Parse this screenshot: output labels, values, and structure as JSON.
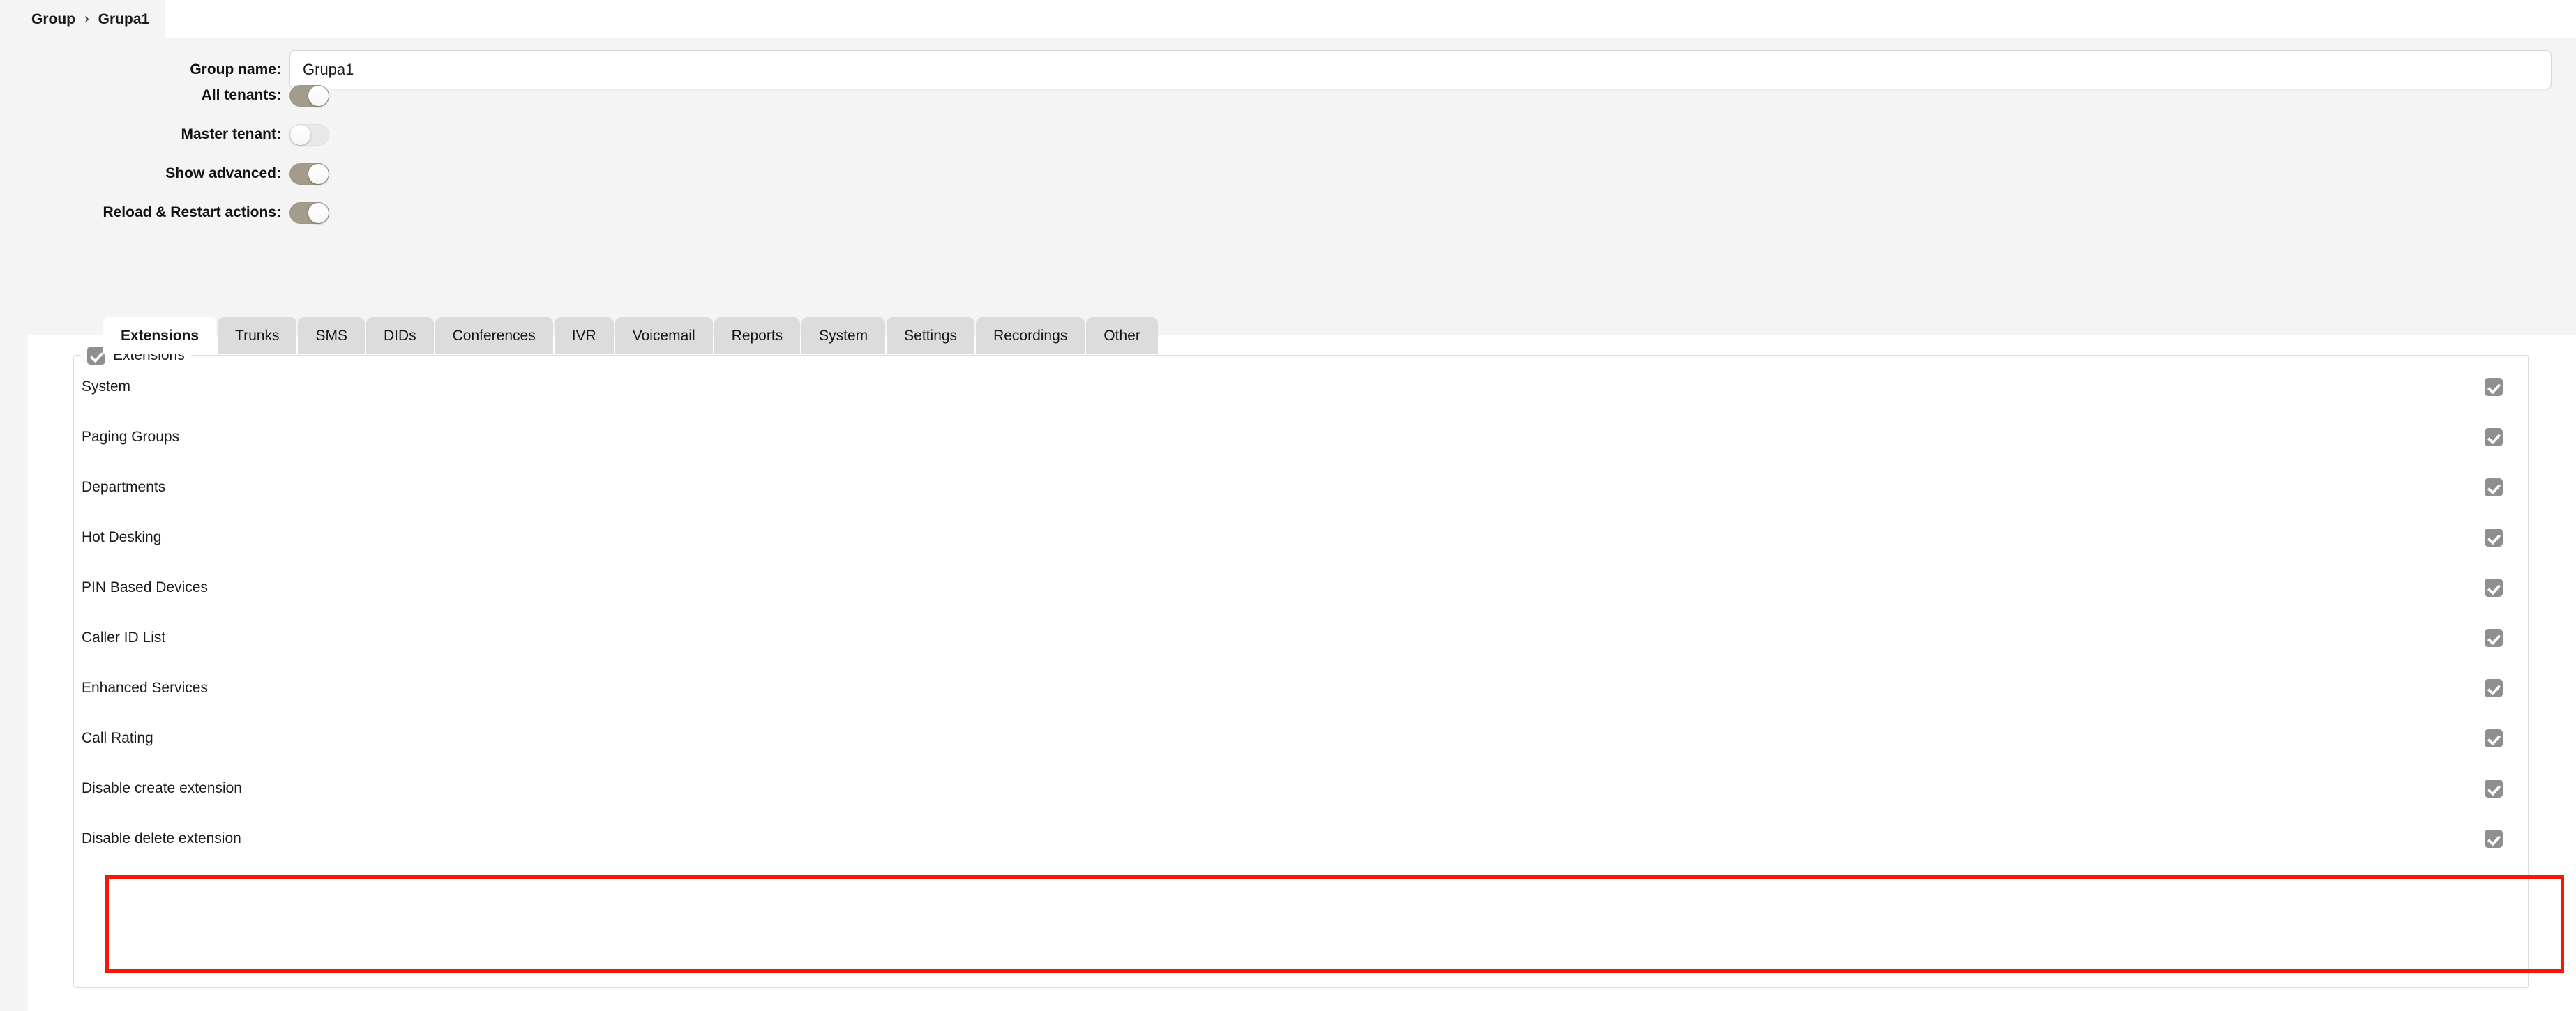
{
  "breadcrumb": {
    "root": "Group",
    "separator": "›",
    "current": "Grupa1"
  },
  "form": {
    "group_name": {
      "label": "Group name:",
      "value": "Grupa1",
      "placeholder": ""
    },
    "toggles": [
      {
        "label": "All tenants:",
        "state": "on"
      },
      {
        "label": "Master tenant:",
        "state": "off"
      },
      {
        "label": "Show advanced:",
        "state": "on"
      },
      {
        "label": "Reload & Restart actions:",
        "state": "on"
      }
    ]
  },
  "tabs": [
    {
      "label": "Extensions",
      "active": true
    },
    {
      "label": "Trunks",
      "active": false
    },
    {
      "label": "SMS",
      "active": false
    },
    {
      "label": "DIDs",
      "active": false
    },
    {
      "label": "Conferences",
      "active": false
    },
    {
      "label": "IVR",
      "active": false
    },
    {
      "label": "Voicemail",
      "active": false
    },
    {
      "label": "Reports",
      "active": false
    },
    {
      "label": "System",
      "active": false
    },
    {
      "label": "Settings",
      "active": false
    },
    {
      "label": "Recordings",
      "active": false
    },
    {
      "label": "Other",
      "active": false
    }
  ],
  "panel": {
    "legend": {
      "label": "Extensions",
      "checked": true
    },
    "options": [
      {
        "label": "System",
        "checked": true
      },
      {
        "label": "Paging Groups",
        "checked": true
      },
      {
        "label": "Departments",
        "checked": true
      },
      {
        "label": "Hot Desking",
        "checked": true
      },
      {
        "label": "PIN Based Devices",
        "checked": true
      },
      {
        "label": "Caller ID List",
        "checked": true
      },
      {
        "label": "Enhanced Services",
        "checked": true
      },
      {
        "label": "Call Rating",
        "checked": true
      },
      {
        "label": "Disable create extension",
        "checked": true
      },
      {
        "label": "Disable delete extension",
        "checked": true
      }
    ]
  },
  "annotation": {
    "color": "#fa1505",
    "highlighted": [
      "Disable create extension",
      "Disable delete extension"
    ]
  },
  "colors": {
    "toggle_on": "#a39b8b",
    "toggle_off": "#e9e9e9",
    "checkbox": "#8f8f8f",
    "tab_inactive": "#dcdcdc",
    "tab_active": "#ffffff",
    "page_grey": "#f4f4f4",
    "annotation_red": "#fa1505"
  }
}
